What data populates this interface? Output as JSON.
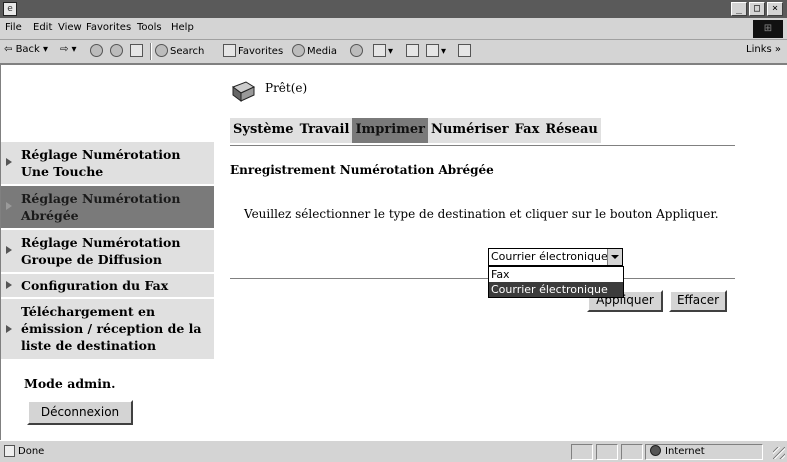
{
  "menubar": {
    "items": [
      "File",
      "Edit",
      "View",
      "Favorites",
      "Tools",
      "Help"
    ]
  },
  "toolbar": {
    "back": "Back",
    "search": "Search",
    "favorites": "Favorites",
    "media": "Media",
    "links": "Links »"
  },
  "window_buttons": {
    "minimize": "_",
    "maximize": "□",
    "close": "×"
  },
  "page": {
    "status_text": "Prêt(e)",
    "tabs": [
      {
        "label": "Système",
        "active": false
      },
      {
        "label": "Travail",
        "active": false
      },
      {
        "label": "Imprimer",
        "active": true
      },
      {
        "label": "Numériser",
        "active": false
      },
      {
        "label": "Fax",
        "active": false
      },
      {
        "label": "Réseau",
        "active": false
      }
    ],
    "section_title": "Enregistrement Numérotation Abrégée",
    "instruction": "Veuillez sélectionner le type de destination et cliquer sur le bouton Appliquer.",
    "select_value": "Courrier électronique",
    "dropdown_options": [
      "Fax",
      "Courrier électronique"
    ],
    "apply_label": "Appliquer",
    "clear_label": "Effacer"
  },
  "sidebar": {
    "items": [
      {
        "label": "Réglage Numérotation Une Touche",
        "active": false
      },
      {
        "label": "Réglage Numérotation Abrégée",
        "active": true
      },
      {
        "label": "Réglage Numérotation Groupe de Diffusion",
        "active": false
      },
      {
        "label": "Configuration du Fax",
        "active": false
      },
      {
        "label": "Téléchargement en émission / réception de la liste de destination",
        "active": false
      }
    ],
    "admin_label": "Mode admin.",
    "logout_label": "Déconnexion"
  },
  "statusbar": {
    "status": "Done",
    "zone": "Internet"
  },
  "colors": {
    "active_tab": "#7a7a7a",
    "inactive_tab": "#e0e0e0",
    "chrome": "#d4d4d4",
    "selected_option": "#3c3c3c"
  }
}
